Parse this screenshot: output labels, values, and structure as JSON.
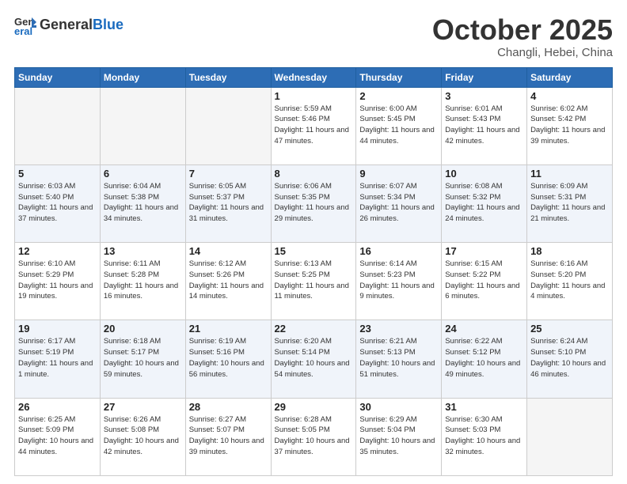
{
  "header": {
    "logo_general": "General",
    "logo_blue": "Blue",
    "month": "October 2025",
    "location": "Changli, Hebei, China"
  },
  "days_of_week": [
    "Sunday",
    "Monday",
    "Tuesday",
    "Wednesday",
    "Thursday",
    "Friday",
    "Saturday"
  ],
  "weeks": [
    [
      {
        "day": "",
        "info": ""
      },
      {
        "day": "",
        "info": ""
      },
      {
        "day": "",
        "info": ""
      },
      {
        "day": "1",
        "info": "Sunrise: 5:59 AM\nSunset: 5:46 PM\nDaylight: 11 hours\nand 47 minutes."
      },
      {
        "day": "2",
        "info": "Sunrise: 6:00 AM\nSunset: 5:45 PM\nDaylight: 11 hours\nand 44 minutes."
      },
      {
        "day": "3",
        "info": "Sunrise: 6:01 AM\nSunset: 5:43 PM\nDaylight: 11 hours\nand 42 minutes."
      },
      {
        "day": "4",
        "info": "Sunrise: 6:02 AM\nSunset: 5:42 PM\nDaylight: 11 hours\nand 39 minutes."
      }
    ],
    [
      {
        "day": "5",
        "info": "Sunrise: 6:03 AM\nSunset: 5:40 PM\nDaylight: 11 hours\nand 37 minutes."
      },
      {
        "day": "6",
        "info": "Sunrise: 6:04 AM\nSunset: 5:38 PM\nDaylight: 11 hours\nand 34 minutes."
      },
      {
        "day": "7",
        "info": "Sunrise: 6:05 AM\nSunset: 5:37 PM\nDaylight: 11 hours\nand 31 minutes."
      },
      {
        "day": "8",
        "info": "Sunrise: 6:06 AM\nSunset: 5:35 PM\nDaylight: 11 hours\nand 29 minutes."
      },
      {
        "day": "9",
        "info": "Sunrise: 6:07 AM\nSunset: 5:34 PM\nDaylight: 11 hours\nand 26 minutes."
      },
      {
        "day": "10",
        "info": "Sunrise: 6:08 AM\nSunset: 5:32 PM\nDaylight: 11 hours\nand 24 minutes."
      },
      {
        "day": "11",
        "info": "Sunrise: 6:09 AM\nSunset: 5:31 PM\nDaylight: 11 hours\nand 21 minutes."
      }
    ],
    [
      {
        "day": "12",
        "info": "Sunrise: 6:10 AM\nSunset: 5:29 PM\nDaylight: 11 hours\nand 19 minutes."
      },
      {
        "day": "13",
        "info": "Sunrise: 6:11 AM\nSunset: 5:28 PM\nDaylight: 11 hours\nand 16 minutes."
      },
      {
        "day": "14",
        "info": "Sunrise: 6:12 AM\nSunset: 5:26 PM\nDaylight: 11 hours\nand 14 minutes."
      },
      {
        "day": "15",
        "info": "Sunrise: 6:13 AM\nSunset: 5:25 PM\nDaylight: 11 hours\nand 11 minutes."
      },
      {
        "day": "16",
        "info": "Sunrise: 6:14 AM\nSunset: 5:23 PM\nDaylight: 11 hours\nand 9 minutes."
      },
      {
        "day": "17",
        "info": "Sunrise: 6:15 AM\nSunset: 5:22 PM\nDaylight: 11 hours\nand 6 minutes."
      },
      {
        "day": "18",
        "info": "Sunrise: 6:16 AM\nSunset: 5:20 PM\nDaylight: 11 hours\nand 4 minutes."
      }
    ],
    [
      {
        "day": "19",
        "info": "Sunrise: 6:17 AM\nSunset: 5:19 PM\nDaylight: 11 hours\nand 1 minute."
      },
      {
        "day": "20",
        "info": "Sunrise: 6:18 AM\nSunset: 5:17 PM\nDaylight: 10 hours\nand 59 minutes."
      },
      {
        "day": "21",
        "info": "Sunrise: 6:19 AM\nSunset: 5:16 PM\nDaylight: 10 hours\nand 56 minutes."
      },
      {
        "day": "22",
        "info": "Sunrise: 6:20 AM\nSunset: 5:14 PM\nDaylight: 10 hours\nand 54 minutes."
      },
      {
        "day": "23",
        "info": "Sunrise: 6:21 AM\nSunset: 5:13 PM\nDaylight: 10 hours\nand 51 minutes."
      },
      {
        "day": "24",
        "info": "Sunrise: 6:22 AM\nSunset: 5:12 PM\nDaylight: 10 hours\nand 49 minutes."
      },
      {
        "day": "25",
        "info": "Sunrise: 6:24 AM\nSunset: 5:10 PM\nDaylight: 10 hours\nand 46 minutes."
      }
    ],
    [
      {
        "day": "26",
        "info": "Sunrise: 6:25 AM\nSunset: 5:09 PM\nDaylight: 10 hours\nand 44 minutes."
      },
      {
        "day": "27",
        "info": "Sunrise: 6:26 AM\nSunset: 5:08 PM\nDaylight: 10 hours\nand 42 minutes."
      },
      {
        "day": "28",
        "info": "Sunrise: 6:27 AM\nSunset: 5:07 PM\nDaylight: 10 hours\nand 39 minutes."
      },
      {
        "day": "29",
        "info": "Sunrise: 6:28 AM\nSunset: 5:05 PM\nDaylight: 10 hours\nand 37 minutes."
      },
      {
        "day": "30",
        "info": "Sunrise: 6:29 AM\nSunset: 5:04 PM\nDaylight: 10 hours\nand 35 minutes."
      },
      {
        "day": "31",
        "info": "Sunrise: 6:30 AM\nSunset: 5:03 PM\nDaylight: 10 hours\nand 32 minutes."
      },
      {
        "day": "",
        "info": ""
      }
    ]
  ]
}
